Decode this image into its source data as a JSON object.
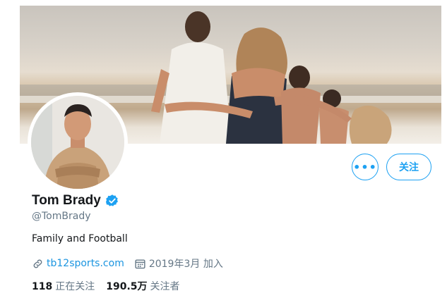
{
  "profile": {
    "name": "Tom Brady",
    "handle": "@TomBrady",
    "bio": "Family and Football",
    "website": "tb12sports.com",
    "joined": "2019年3月 加入",
    "verified": true
  },
  "actions": {
    "more_label": "•••",
    "follow_label": "关注"
  },
  "stats": {
    "following_count": "118",
    "following_label": "正在关注",
    "followers_count": "190.5万",
    "followers_label": "关注者"
  },
  "colors": {
    "accent": "#1da1f2",
    "link": "#1b95e0",
    "secondary_text": "#657786",
    "primary_text": "#14171a"
  },
  "icons": {
    "website": "link-icon",
    "joined": "calendar-icon",
    "verified": "verified-badge-icon",
    "more": "more-icon"
  }
}
